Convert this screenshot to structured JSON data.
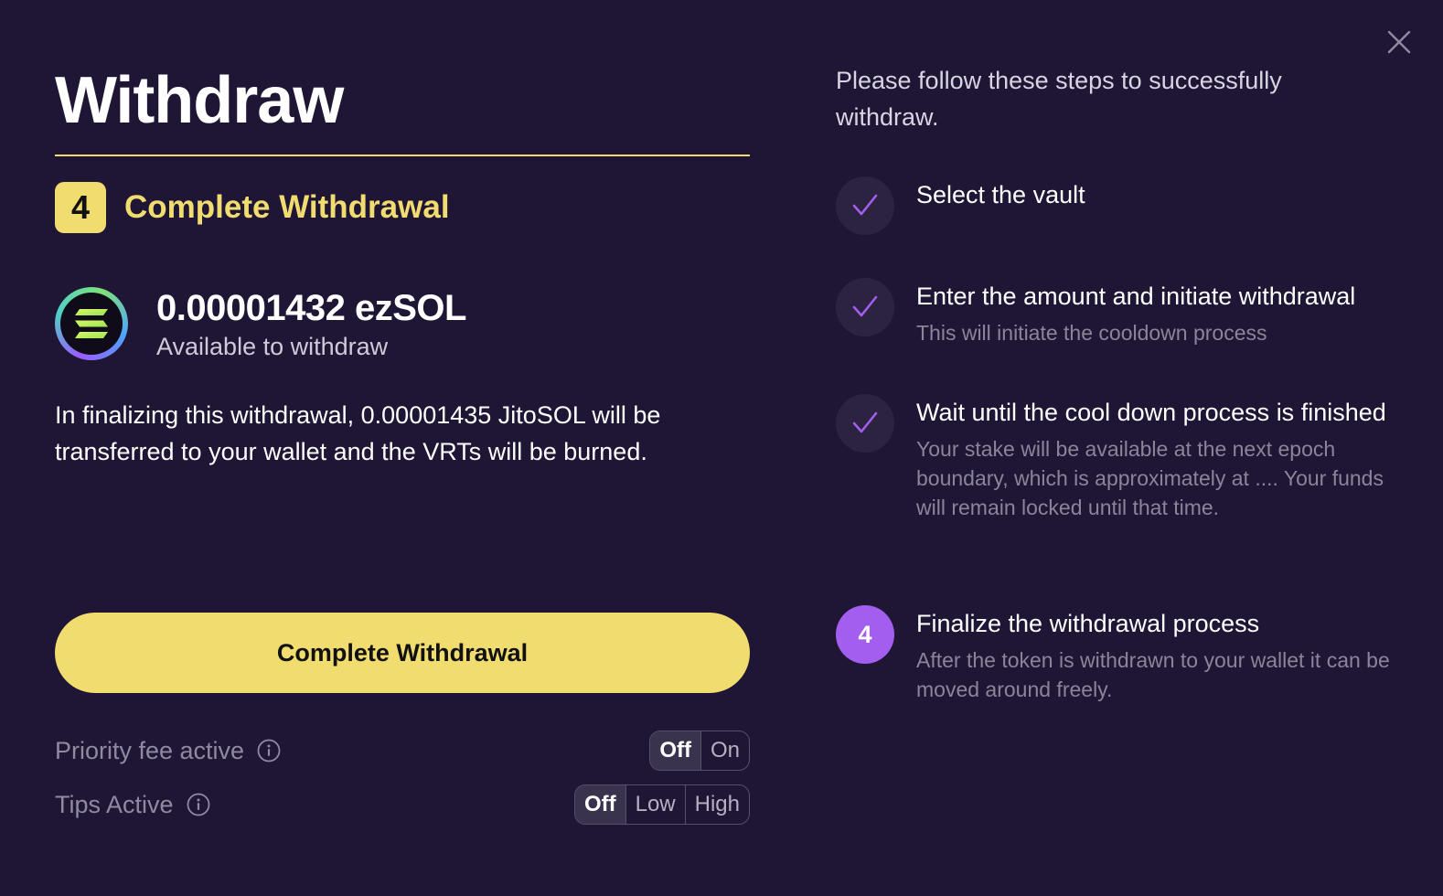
{
  "modal": {
    "title": "Withdraw",
    "close_icon": "close-icon"
  },
  "current_step": {
    "number": "4",
    "label": "Complete Withdrawal"
  },
  "token": {
    "amount": "0.00001432 ezSOL",
    "subtitle": "Available to withdraw",
    "icon": "solana-token-icon"
  },
  "finalize_message": "In finalizing this withdrawal, 0.00001435 JitoSOL will be transferred to your wallet and the VRTs will be burned.",
  "primary_button": {
    "label": "Complete Withdrawal"
  },
  "settings": {
    "priority_fee": {
      "label": "Priority fee active",
      "options": [
        "Off",
        "On"
      ],
      "selected": "Off"
    },
    "tips": {
      "label": "Tips Active",
      "options": [
        "Off",
        "Low",
        "High"
      ],
      "selected": "Off"
    }
  },
  "instructions": {
    "intro": "Please follow these steps to successfully withdraw.",
    "steps": [
      {
        "status": "done",
        "title": "Select the vault",
        "description": ""
      },
      {
        "status": "done",
        "title": "Enter the amount and initiate withdrawal",
        "description": "This will initiate the cooldown process"
      },
      {
        "status": "done",
        "title": "Wait until the cool down process is finished",
        "description": "Your stake will be available at the next epoch boundary, which is approximately at .... Your funds will remain locked until that time."
      },
      {
        "status": "current",
        "number": "4",
        "title": "Finalize the withdrawal process",
        "description": "After the token is withdrawn to your wallet it can be moved around freely."
      }
    ]
  },
  "colors": {
    "background": "#1f1635",
    "accent_yellow": "#f1dc6f",
    "accent_purple": "#a35ef0",
    "check_purple": "#a35ef0"
  }
}
